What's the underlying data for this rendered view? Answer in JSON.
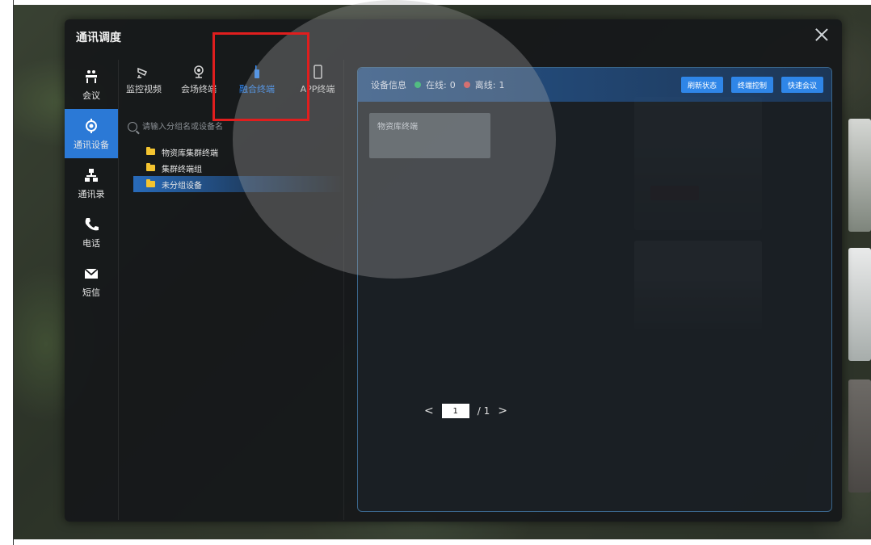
{
  "dialog": {
    "title": "通讯调度"
  },
  "side_nav": [
    {
      "label": "会议",
      "icon": "meeting-icon",
      "active": false
    },
    {
      "label": "通讯设备",
      "icon": "device-icon",
      "active": true
    },
    {
      "label": "通讯录",
      "icon": "contacts-icon",
      "active": false
    },
    {
      "label": "电话",
      "icon": "phone-icon",
      "active": false
    },
    {
      "label": "短信",
      "icon": "sms-icon",
      "active": false
    }
  ],
  "tabs": [
    {
      "label": "监控视频",
      "icon": "camera-icon",
      "active": false
    },
    {
      "label": "会场终端",
      "icon": "webcam-icon",
      "active": false
    },
    {
      "label": "融合终端",
      "icon": "radio-icon",
      "active": true
    },
    {
      "label": "APP终端",
      "icon": "mobile-icon",
      "active": false
    }
  ],
  "search": {
    "placeholder": "请输入分组名或设备名"
  },
  "tree": [
    {
      "label": "物资库集群终端",
      "selected": false
    },
    {
      "label": "集群终端组",
      "selected": false
    },
    {
      "label": "未分组设备",
      "selected": true
    }
  ],
  "device_panel": {
    "header_label": "设备信息",
    "online_label": "在线:",
    "online_count": "0",
    "offline_label": "离线:",
    "offline_count": "1",
    "buttons": [
      "刷新状态",
      "终端控制",
      "快速会议"
    ],
    "card_label": "物资库终端"
  },
  "pager": {
    "current": "1",
    "total": "/ 1",
    "prev": "<",
    "next": ">"
  },
  "colors": {
    "accent": "#2b79d6",
    "highlight": "#e01e1e",
    "online": "#28c76f",
    "offline": "#ea5455"
  }
}
